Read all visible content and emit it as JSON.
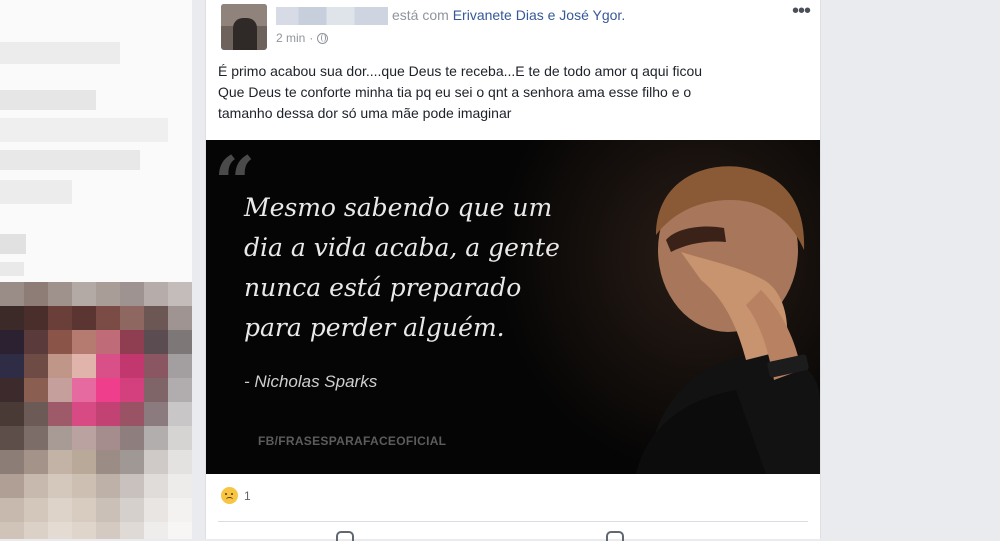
{
  "post": {
    "author_hidden": "",
    "header_with": "está com",
    "tagged_names": "Erivanete Dias e José Ygor.",
    "timestamp": "2 min",
    "separator": "·",
    "more_icon": "•••",
    "text_lines": [
      "É primo acabou sua dor....que Deus te receba...E te de todo amor q aqui ficou",
      "Que Deus te conforte minha tia pq eu sei o qnt a senhora ama esse filho e o",
      "tamanho dessa dor só uma mãe pode imaginar"
    ],
    "image": {
      "quote_mark": "“",
      "quote_lines": [
        "Mesmo sabendo que um",
        "dia a vida acaba, a gente",
        "nunca está preparado",
        "para perder alguém."
      ],
      "author": "- Nicholas Sparks",
      "watermark": "FB/FRASESPARAFACEOFICIAL"
    },
    "reactions": {
      "icon": "sad-reaction",
      "count": "1"
    }
  },
  "colors": {
    "link": "#365899",
    "meta_gray": "#90949c",
    "text": "#1d2129",
    "page_bg": "#e9ebee"
  }
}
